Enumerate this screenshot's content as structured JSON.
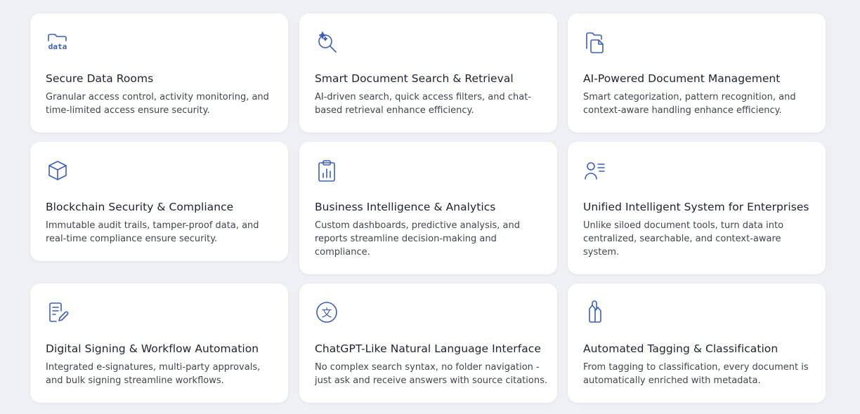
{
  "accent_color": "#3b5fb8",
  "cards": [
    {
      "icon": "folder-data-icon",
      "icon_text": "data",
      "title": "Secure Data Rooms",
      "description": "Granular access control, activity monitoring, and time-limited access ensure security."
    },
    {
      "icon": "sparkle-search-icon",
      "title": "Smart Document Search & Retrieval",
      "description": "AI-driven search, quick access filters, and chat-based retrieval enhance efficiency."
    },
    {
      "icon": "documents-icon",
      "title": "AI-Powered Document Management",
      "description": "Smart categorization, pattern recognition, and context-aware handling enhance efficiency."
    },
    {
      "icon": "cube-icon",
      "title": "Blockchain Security & Compliance",
      "description": "Immutable audit trails, tamper-proof data, and real-time compliance ensure security."
    },
    {
      "icon": "clipboard-chart-icon",
      "title": "Business Intelligence & Analytics",
      "description": "Custom dashboards, predictive analysis, and reports streamline decision-making and compliance."
    },
    {
      "icon": "user-list-icon",
      "title": "Unified Intelligent System for Enterprises",
      "description": "Unlike siloed document tools, turn data into centralized, searchable, and context-aware system."
    },
    {
      "icon": "document-sign-icon",
      "title": "Digital Signing & Workflow Automation",
      "description": "Integrated e-signatures, multi-party approvals, and bulk signing streamline workflows."
    },
    {
      "icon": "translate-icon",
      "icon_text": "文",
      "title": "ChatGPT-Like Natural Language Interface",
      "description": "No complex search syntax, no folder navigation - just ask and receive answers with source citations."
    },
    {
      "icon": "tags-icon",
      "title": "Automated Tagging & Classification",
      "description": "From tagging to classification, every document is automatically enriched with metadata."
    }
  ]
}
